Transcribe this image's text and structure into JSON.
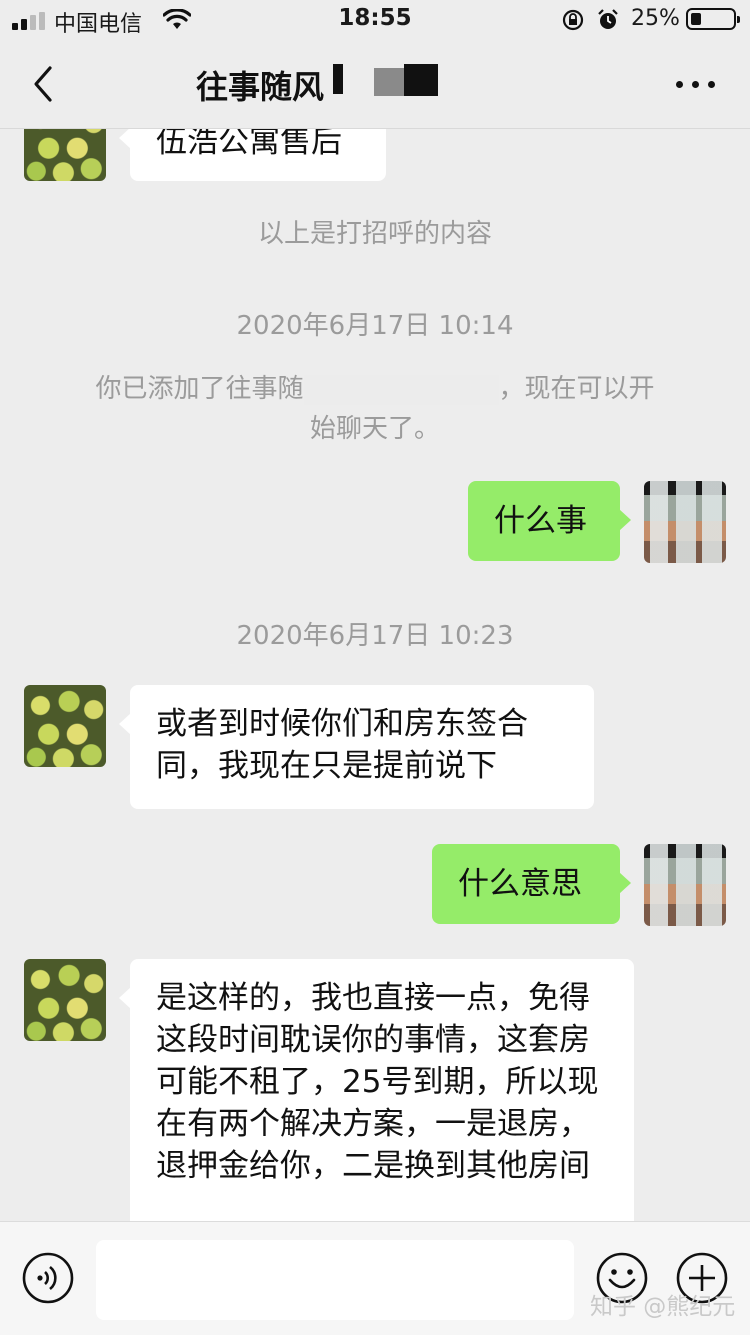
{
  "status_bar": {
    "carrier": "中国电信",
    "time": "18:55",
    "battery": "25%"
  },
  "nav": {
    "title": "往事随风"
  },
  "messages": {
    "m1": "伍浩公寓售后",
    "sys_greeting": "以上是打招呼的内容",
    "ts1": "2020年6月17日 10:14",
    "added_a": "你已添加了往事随",
    "added_b": "，现在可以开",
    "added_c": "始聊天了。",
    "m2": "什么事",
    "ts2": "2020年6月17日 10:23",
    "m3": "或者到时候你们和房东签合同，我现在只是提前说下",
    "m4": "什么意思",
    "m5": "是这样的，我也直接一点，免得这段时间耽误你的事情，这套房可能不租了，25号到期，所以现在有两个解决方案，一是退房，退押金给你，二是换到其他房间"
  },
  "input": {
    "placeholder": ""
  },
  "watermark": "知乎 @熊纪元",
  "colors": {
    "background": "#ededed",
    "outgoing_bubble": "#95ec69",
    "incoming_bubble": "#ffffff",
    "system_text": "#9b9b9b"
  },
  "icons": [
    "signal-icon",
    "wifi-icon",
    "lock-rotation-icon",
    "alarm-icon",
    "battery-icon",
    "back-icon",
    "more-icon",
    "voice-icon",
    "emoji-icon",
    "plus-icon"
  ]
}
